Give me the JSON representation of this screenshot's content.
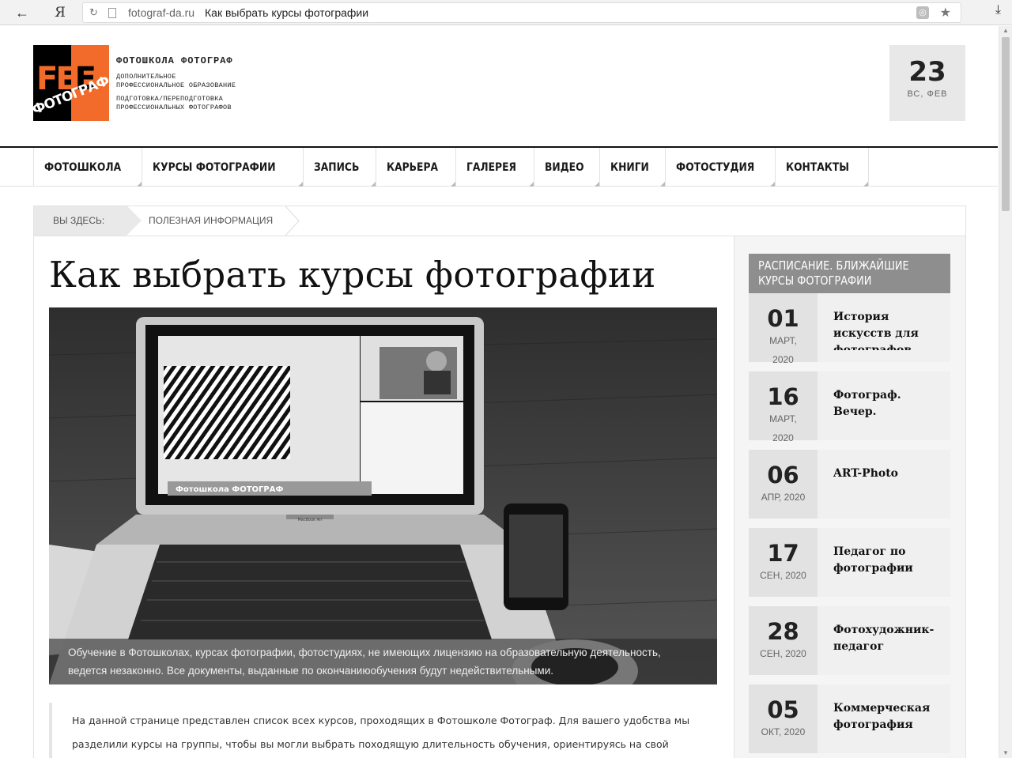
{
  "browser": {
    "yandex_glyph": "Я",
    "domain": "fotograf-da.ru",
    "page_title": "Как выбрать курсы фотографии"
  },
  "header": {
    "logo_word": "ФОТОГРАФ",
    "school_name": "ФОТОШКОЛА ФОТОГРАФ",
    "lines": [
      "ДОПОЛНИТЕЛЬНОЕ",
      "ПРОФЕССИОНАЛЬНОЕ ОБРАЗОВАНИЕ",
      "ПОДГОТОВКА/ПЕРЕПОДГОТОВКА",
      "ПРОФЕССИОНАЛЬНЫХ ФОТОГРАФОВ"
    ],
    "date_day": "23",
    "date_sub": "ВС, ФЕВ"
  },
  "nav": [
    "ФОТОШКОЛА",
    "КУРСЫ ФОТОГРАФИИ",
    "ЗАПИСЬ",
    "КАРЬЕРА",
    "ГАЛЕРЕЯ",
    "ВИДЕО",
    "КНИГИ",
    "ФОТОСТУДИЯ",
    "КОНТАКТЫ"
  ],
  "breadcrumb": {
    "here_label": "ВЫ ЗДЕСЬ:",
    "current": "ПОЛЕЗНАЯ ИНФОРМАЦИЯ"
  },
  "article": {
    "title": "Как выбрать курсы фотографии",
    "screen_watermark": "Фотошкола ФОТОГРАФ",
    "laptop_label": "MacBook Air",
    "caption": "Обучение в Фотошколах, курсах фотографии, фотостудиях, не имеющих лицензию на образовательную деятельность, ведется незаконно. Все документы, выданные по окончаниюобучения будут недействительными.",
    "quote": "На данной странице представлен список всех курсов, проходящих в Фотошколе Фотограф. Для вашего удобства мы разделили курсы на группы, чтобы вы могли выбрать походящую длительность обучения, ориентируясь на свой"
  },
  "sidebar": {
    "title_line1": "РАСПИСАНИЕ. БЛИЖАЙШИЕ",
    "title_line2": "КУРСЫ ФОТОГРАФИИ",
    "events": [
      {
        "day": "01",
        "month": "МАРТ,",
        "year": "2020",
        "name": "История искусств для фотографов"
      },
      {
        "day": "16",
        "month": "МАРТ,",
        "year": "2020",
        "name": "Фотограф. Вечер."
      },
      {
        "day": "06",
        "month": "АПР, 2020",
        "year": "",
        "name": "ART-Photo"
      },
      {
        "day": "17",
        "month": "СЕН, 2020",
        "year": "",
        "name": "Педагог по фотографии"
      },
      {
        "day": "28",
        "month": "СЕН, 2020",
        "year": "",
        "name": "Фотохудожник-педагог"
      },
      {
        "day": "05",
        "month": "ОКТ, 2020",
        "year": "",
        "name": "Коммерческая фотография"
      }
    ]
  }
}
